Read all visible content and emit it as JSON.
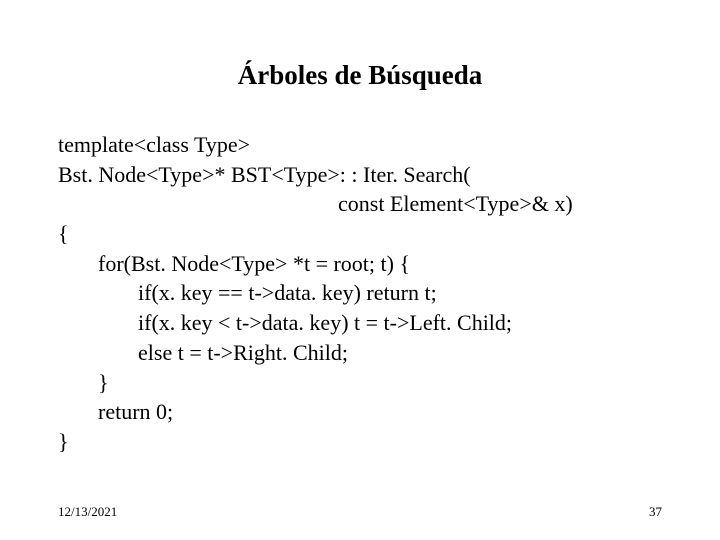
{
  "title": "Árboles de Búsqueda",
  "code": {
    "l1": "template<class Type>",
    "l2": "Bst. Node<Type>* BST<Type>: : Iter. Search(",
    "l3": "const Element<Type>& x)",
    "l4": "{",
    "l5": "for(Bst. Node<Type> *t = root; t) {",
    "l6": "if(x. key == t->data. key) return t;",
    "l7": "if(x. key < t->data. key) t = t->Left. Child;",
    "l8": "else t = t->Right. Child;",
    "l9": "}",
    "l10": "return 0;",
    "l11": "}"
  },
  "footer": {
    "date": "12/13/2021",
    "page": "37"
  }
}
